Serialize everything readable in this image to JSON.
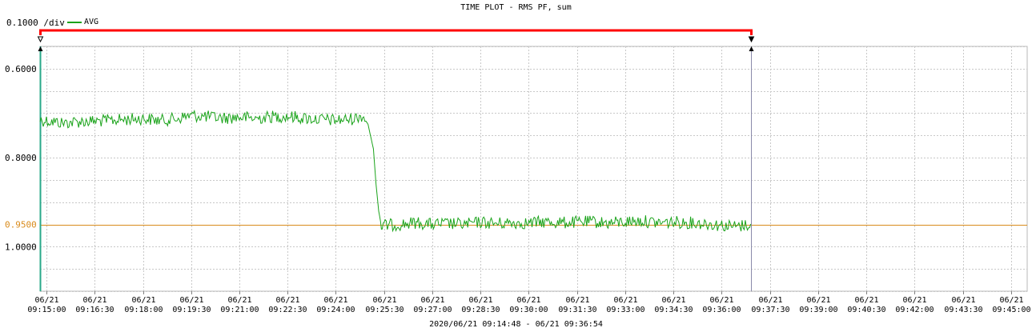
{
  "chart_data": {
    "type": "line",
    "title": "TIME PLOT - RMS  PF, sum",
    "scale_label": "0.1000 /div",
    "date_range": "2020/06/21 09:14:48 - 06/21 09:36:54",
    "y_axis": {
      "ylim": [
        0.55,
        1.1
      ],
      "reversed": true,
      "tick_values": [
        0.6,
        0.8,
        0.95,
        1.0
      ],
      "tick_labels": [
        "0.6000",
        "0.8000",
        "0.9500",
        "1.0000"
      ],
      "gridline_step": 0.05
    },
    "x_axis": {
      "xlim": [
        "09:14:48",
        "09:45:30"
      ],
      "ticks": [
        {
          "time": "09:15:00",
          "date": "06/21",
          "label": "09:15:00"
        },
        {
          "time": "09:16:30",
          "date": "06/21",
          "label": "09:16:30"
        },
        {
          "time": "09:18:00",
          "date": "06/21",
          "label": "09:18:00"
        },
        {
          "time": "09:19:30",
          "date": "06/21",
          "label": "09:19:30"
        },
        {
          "time": "09:21:00",
          "date": "06/21",
          "label": "09:21:00"
        },
        {
          "time": "09:22:30",
          "date": "06/21",
          "label": "09:22:30"
        },
        {
          "time": "09:24:00",
          "date": "06/21",
          "label": "09:24:00"
        },
        {
          "time": "09:25:30",
          "date": "06/21",
          "label": "09:25:30"
        },
        {
          "time": "09:27:00",
          "date": "06/21",
          "label": "09:27:00"
        },
        {
          "time": "09:28:30",
          "date": "06/21",
          "label": "09:28:30"
        },
        {
          "time": "09:30:00",
          "date": "06/21",
          "label": "09:30:00"
        },
        {
          "time": "09:31:30",
          "date": "06/21",
          "label": "09:31:30"
        },
        {
          "time": "09:33:00",
          "date": "06/21",
          "label": "09:33:00"
        },
        {
          "time": "09:34:30",
          "date": "06/21",
          "label": "09:34:30"
        },
        {
          "time": "09:36:00",
          "date": "06/21",
          "label": "09:36:00"
        },
        {
          "time": "09:37:30",
          "date": "06/21",
          "label": "09:37:30"
        },
        {
          "time": "09:39:00",
          "date": "06/21",
          "label": "09:39:00"
        },
        {
          "time": "09:40:30",
          "date": "06/21",
          "label": "09:40:30"
        },
        {
          "time": "09:42:00",
          "date": "06/21",
          "label": "09:42:00"
        },
        {
          "time": "09:43:30",
          "date": "06/21",
          "label": "09:43:30"
        },
        {
          "time": "09:45:00",
          "date": "06/21",
          "label": "09:45:00"
        }
      ]
    },
    "grid": true,
    "legend_position": "top-left",
    "reference_line": {
      "value": 0.95,
      "label": "0.9500",
      "color": "#d98b1c"
    },
    "cursors": [
      {
        "time": "09:14:48",
        "color": "#2aa88a"
      },
      {
        "time": "09:36:54",
        "color": "#8a8aaa"
      }
    ],
    "range_bar": {
      "start": "09:14:48",
      "end": "09:36:54",
      "color": "#ff0000"
    },
    "series": [
      {
        "name": "AVG",
        "color": "#1aa31a",
        "points": [
          [
            "09:14:48",
            0.715
          ],
          [
            "09:15:00",
            0.717
          ],
          [
            "09:15:30",
            0.722
          ],
          [
            "09:16:00",
            0.719
          ],
          [
            "09:16:30",
            0.718
          ],
          [
            "09:17:00",
            0.716
          ],
          [
            "09:17:30",
            0.714
          ],
          [
            "09:18:00",
            0.712
          ],
          [
            "09:18:30",
            0.716
          ],
          [
            "09:19:00",
            0.713
          ],
          [
            "09:19:30",
            0.705
          ],
          [
            "09:20:00",
            0.708
          ],
          [
            "09:20:30",
            0.711
          ],
          [
            "09:21:00",
            0.709
          ],
          [
            "09:21:30",
            0.712
          ],
          [
            "09:22:00",
            0.708
          ],
          [
            "09:22:30",
            0.707
          ],
          [
            "09:23:00",
            0.711
          ],
          [
            "09:23:30",
            0.714
          ],
          [
            "09:24:00",
            0.716
          ],
          [
            "09:24:30",
            0.713
          ],
          [
            "09:24:50",
            0.705
          ],
          [
            "09:25:00",
            0.725
          ],
          [
            "09:25:10",
            0.78
          ],
          [
            "09:25:15",
            0.86
          ],
          [
            "09:25:20",
            0.92
          ],
          [
            "09:25:25",
            0.955
          ],
          [
            "09:25:30",
            0.952
          ],
          [
            "09:26:00",
            0.95
          ],
          [
            "09:26:30",
            0.946
          ],
          [
            "09:27:00",
            0.95
          ],
          [
            "09:27:30",
            0.948
          ],
          [
            "09:28:00",
            0.95
          ],
          [
            "09:28:30",
            0.945
          ],
          [
            "09:29:00",
            0.948
          ],
          [
            "09:29:30",
            0.946
          ],
          [
            "09:30:00",
            0.947
          ],
          [
            "09:30:30",
            0.944
          ],
          [
            "09:31:00",
            0.946
          ],
          [
            "09:31:30",
            0.945
          ],
          [
            "09:32:00",
            0.944
          ],
          [
            "09:32:30",
            0.947
          ],
          [
            "09:33:00",
            0.944
          ],
          [
            "09:33:30",
            0.942
          ],
          [
            "09:34:00",
            0.946
          ],
          [
            "09:34:30",
            0.945
          ],
          [
            "09:35:00",
            0.946
          ],
          [
            "09:35:30",
            0.948
          ],
          [
            "09:36:00",
            0.952
          ],
          [
            "09:36:30",
            0.955
          ],
          [
            "09:36:54",
            0.949
          ]
        ]
      }
    ]
  }
}
